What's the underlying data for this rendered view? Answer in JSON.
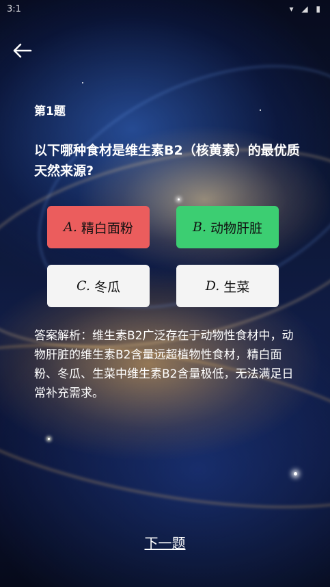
{
  "status_bar": {
    "time": "3:1",
    "icons": "▾ ◢ ▮"
  },
  "header": {
    "back_icon": "arrow-left-icon"
  },
  "quiz": {
    "question_number": "第1题",
    "question": "以下哪种食材是维生素B2（核黄素）的最优质天然来源?",
    "options": [
      {
        "letter": "A.",
        "text": "精白面粉",
        "state": "wrong",
        "color": "#eb5d5d"
      },
      {
        "letter": "B.",
        "text": "动物肝脏",
        "state": "correct",
        "color": "#3cce72"
      },
      {
        "letter": "C.",
        "text": "冬瓜",
        "state": "neutral",
        "color": "#f4f4f4"
      },
      {
        "letter": "D.",
        "text": "生菜",
        "state": "neutral",
        "color": "#f4f4f4"
      }
    ],
    "explanation": "答案解析：维生素B2广泛存在于动物性食材中，动物肝脏的维生素B2含量远超植物性食材，精白面粉、冬瓜、生菜中维生素B2含量极低，无法满足日常补充需求。",
    "next_label": "下一题"
  }
}
